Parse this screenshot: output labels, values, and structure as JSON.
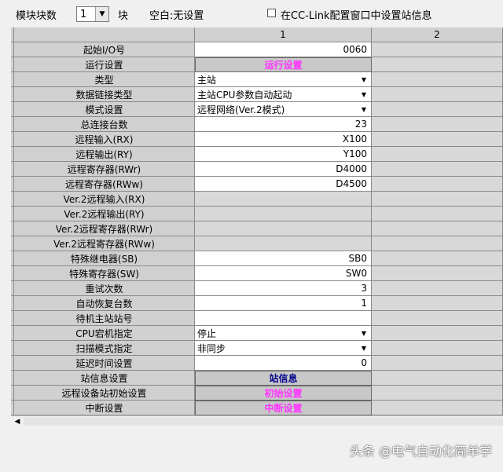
{
  "toolbar": {
    "module_count_label": "模块块数",
    "module_count_value": "1",
    "module_unit": "块",
    "blank_status": "空白:无设置",
    "checkbox_label": "在CC-Link配置窗口中设置站信息"
  },
  "columns": [
    "1",
    "2"
  ],
  "rows": [
    {
      "label": "起始I/O号",
      "value": "0060",
      "type": "text"
    },
    {
      "label": "运行设置",
      "value": "运行设置",
      "type": "button-pink"
    },
    {
      "label": "类型",
      "value": "主站",
      "type": "dropdown"
    },
    {
      "label": "数据链接类型",
      "value": "主站CPU参数自动起动",
      "type": "dropdown"
    },
    {
      "label": "模式设置",
      "value": "远程网络(Ver.2模式)",
      "type": "dropdown"
    },
    {
      "label": "总连接台数",
      "value": "23",
      "type": "text"
    },
    {
      "label": "远程输入(RX)",
      "value": "X100",
      "type": "text"
    },
    {
      "label": "远程输出(RY)",
      "value": "Y100",
      "type": "text"
    },
    {
      "label": "远程寄存器(RWr)",
      "value": "D4000",
      "type": "text"
    },
    {
      "label": "远程寄存器(RWw)",
      "value": "D4500",
      "type": "text"
    },
    {
      "label": "Ver.2远程输入(RX)",
      "value": "",
      "type": "disabled"
    },
    {
      "label": "Ver.2远程输出(RY)",
      "value": "",
      "type": "disabled"
    },
    {
      "label": "Ver.2远程寄存器(RWr)",
      "value": "",
      "type": "disabled"
    },
    {
      "label": "Ver.2远程寄存器(RWw)",
      "value": "",
      "type": "disabled"
    },
    {
      "label": "特殊继电器(SB)",
      "value": "SB0",
      "type": "text"
    },
    {
      "label": "特殊寄存器(SW)",
      "value": "SW0",
      "type": "text"
    },
    {
      "label": "重试次数",
      "value": "3",
      "type": "text"
    },
    {
      "label": "自动恢复台数",
      "value": "1",
      "type": "text"
    },
    {
      "label": "待机主站站号",
      "value": "",
      "type": "text"
    },
    {
      "label": "CPU宕机指定",
      "value": "停止",
      "type": "dropdown"
    },
    {
      "label": "扫描模式指定",
      "value": "非同步",
      "type": "dropdown"
    },
    {
      "label": "延迟时间设置",
      "value": "0",
      "type": "text"
    },
    {
      "label": "站信息设置",
      "value": "站信息",
      "type": "button-blue"
    },
    {
      "label": "远程设备站初始设置",
      "value": "初始设置",
      "type": "button-pink"
    },
    {
      "label": "中断设置",
      "value": "中断设置",
      "type": "button-pink"
    }
  ],
  "watermark": "头条 @电气自动化简单学"
}
